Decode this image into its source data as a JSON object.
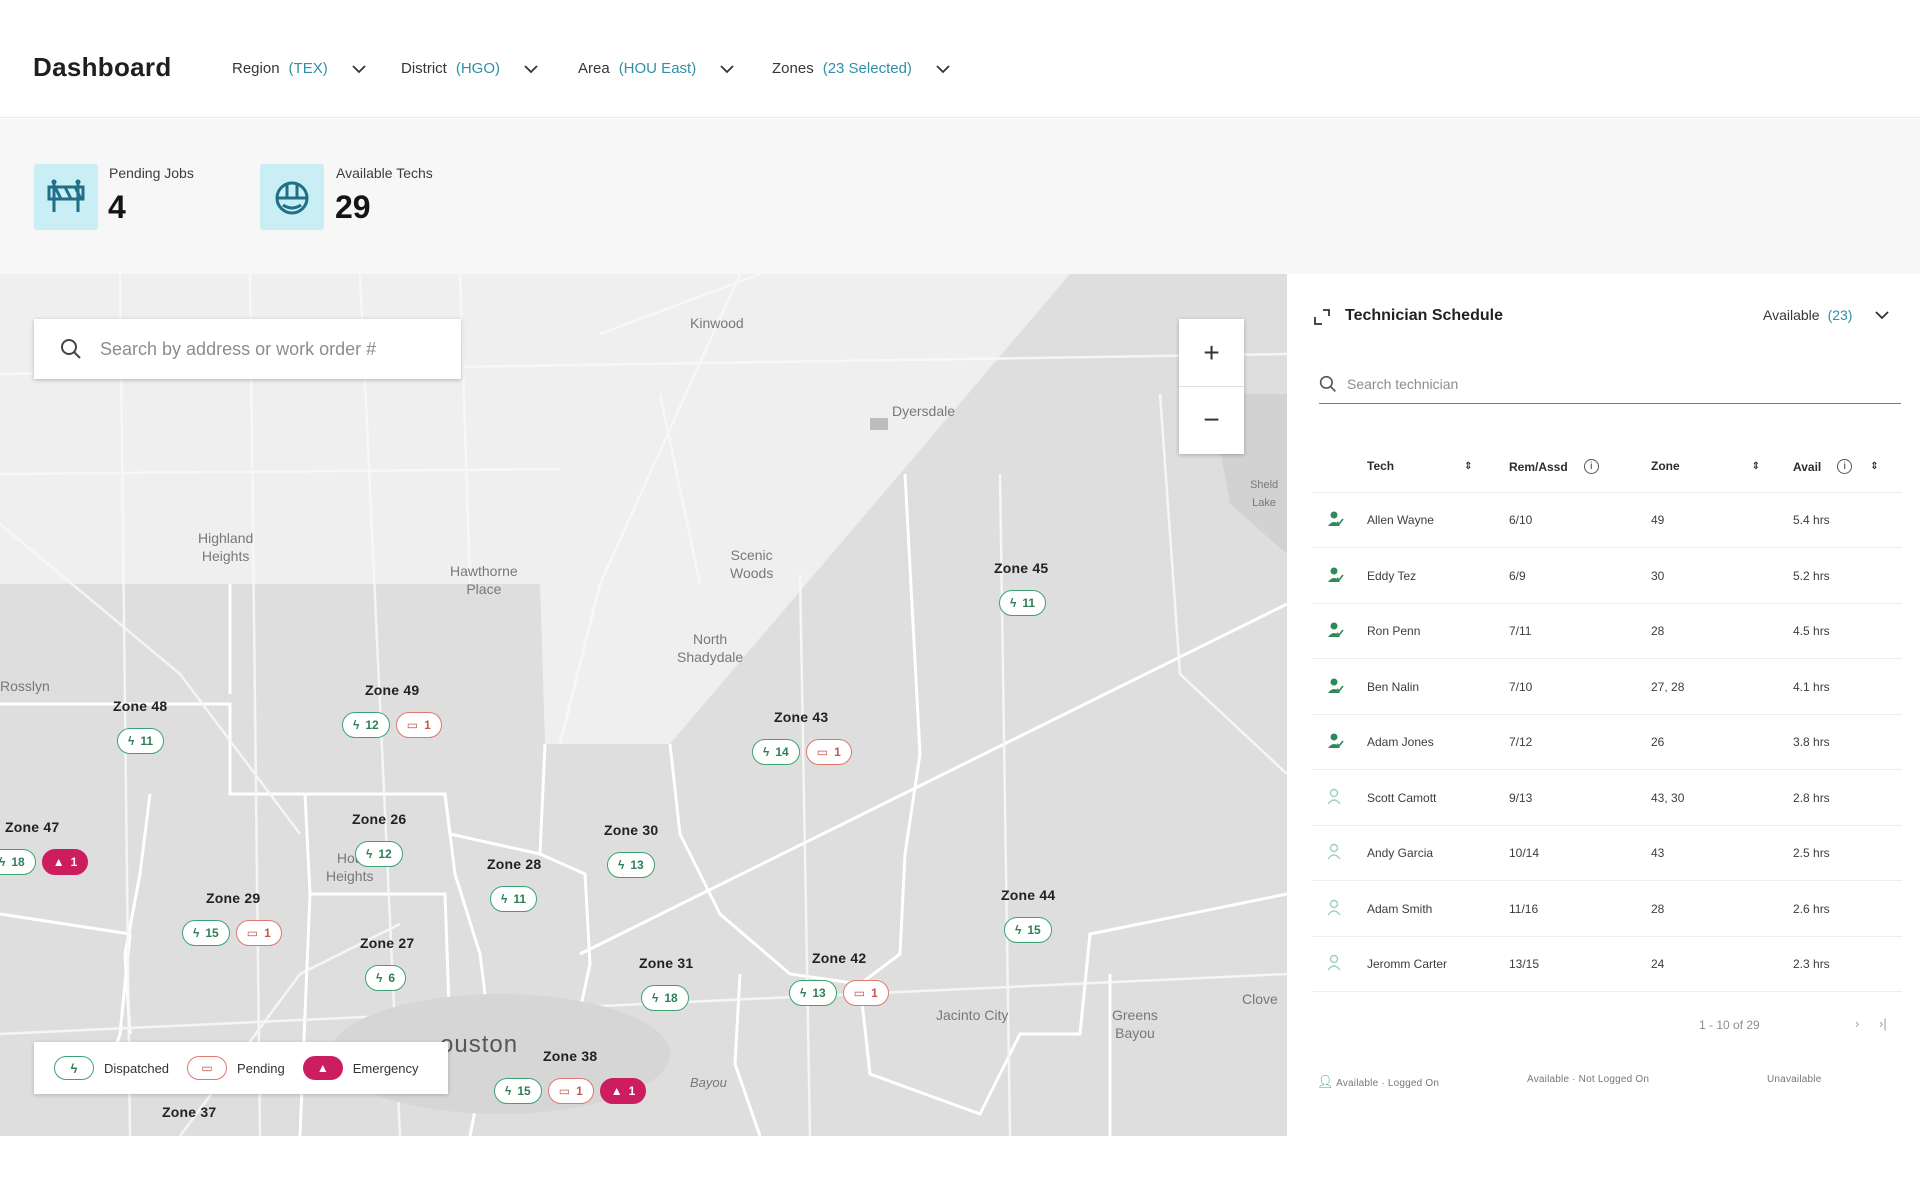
{
  "header": {
    "title": "Dashboard",
    "filters": [
      {
        "label": "Region",
        "value": "(TEX)"
      },
      {
        "label": "District",
        "value": "(HGO)"
      },
      {
        "label": "Area",
        "value": "(HOU East)"
      },
      {
        "label": "Zones",
        "value": "(23 Selected)"
      }
    ]
  },
  "stats": {
    "pending_label": "Pending Jobs",
    "pending_value": "4",
    "techs_label": "Available Techs",
    "techs_value": "29"
  },
  "map": {
    "search_placeholder": "Search by address or work order #",
    "zoom_in": "+",
    "zoom_out": "−",
    "places": {
      "kinwood": "Kinwood",
      "dyersdale": "Dyersdale",
      "highland": "Highland\nHeights",
      "hawthorne": "Hawthorne\nPlace",
      "scenic": "Scenic\nWoods",
      "north_shadydale": "North\nShadydale",
      "rosslyn": "Rosslyn",
      "hou_heights": "Hou\nHeights",
      "houston": "ouston",
      "jacinto": "Jacinto City",
      "greens": "Greens\nBayou",
      "clover": "Clove",
      "sheldon": "Sheld\nLake",
      "bayou": "Bayou"
    },
    "zones": {
      "z45": {
        "name": "Zone 45",
        "dispatched": "11"
      },
      "z48": {
        "name": "Zone 48",
        "dispatched": "11"
      },
      "z49": {
        "name": "Zone 49",
        "dispatched": "12",
        "pending": "1"
      },
      "z43": {
        "name": "Zone 43",
        "dispatched": "14",
        "pending": "1"
      },
      "z47": {
        "name": "Zone 47",
        "dispatched": "18",
        "emergency": "1"
      },
      "z26": {
        "name": "Zone 26",
        "dispatched": "12"
      },
      "z30": {
        "name": "Zone 30",
        "dispatched": "13"
      },
      "z28": {
        "name": "Zone 28",
        "dispatched": "11"
      },
      "z29": {
        "name": "Zone 29",
        "dispatched": "15",
        "pending": "1"
      },
      "z44": {
        "name": "Zone 44",
        "dispatched": "15"
      },
      "z27": {
        "name": "Zone 27",
        "dispatched": "6"
      },
      "z42": {
        "name": "Zone 42",
        "dispatched": "13",
        "pending": "1"
      },
      "z31": {
        "name": "Zone 31",
        "dispatched": "18"
      },
      "z38": {
        "name": "Zone 38",
        "dispatched": "15",
        "pending": "1",
        "emergency": "1"
      },
      "z37": {
        "name": "Zone 37"
      }
    },
    "legend": {
      "dispatched": "Dispatched",
      "pending": "Pending",
      "emergency": "Emergency"
    }
  },
  "panel": {
    "title": "Technician Schedule",
    "filter_label": "Available",
    "filter_value": "(23)",
    "search_placeholder": "Search technician",
    "columns": {
      "tech": "Tech",
      "rem": "Rem/Assd",
      "zone": "Zone",
      "avail": "Avail"
    },
    "rows": [
      {
        "tech": "Allen Wayne",
        "rem": "6/10",
        "zone": "49",
        "avail": "5.4 hrs",
        "status": "logged-on"
      },
      {
        "tech": "Eddy Tez",
        "rem": "6/9",
        "zone": "30",
        "avail": "5.2 hrs",
        "status": "logged-on"
      },
      {
        "tech": "Ron Penn",
        "rem": "7/11",
        "zone": "28",
        "avail": "4.5 hrs",
        "status": "logged-on"
      },
      {
        "tech": "Ben Nalin",
        "rem": "7/10",
        "zone": "27, 28",
        "avail": "4.1 hrs",
        "status": "logged-on"
      },
      {
        "tech": "Adam Jones",
        "rem": "7/12",
        "zone": "26",
        "avail": "3.8 hrs",
        "status": "logged-on"
      },
      {
        "tech": "Scott Camott",
        "rem": "9/13",
        "zone": "43, 30",
        "avail": "2.8 hrs",
        "status": "not-logged-on"
      },
      {
        "tech": "Andy Garcia",
        "rem": "10/14",
        "zone": "43",
        "avail": "2.5 hrs",
        "status": "not-logged-on"
      },
      {
        "tech": "Adam Smith",
        "rem": "11/16",
        "zone": "28",
        "avail": "2.6 hrs",
        "status": "not-logged-on"
      },
      {
        "tech": "Jeromm Carter",
        "rem": "13/15",
        "zone": "24",
        "avail": "2.3 hrs",
        "status": "not-logged-on"
      }
    ],
    "pager": "1 - 10 of 29",
    "pager_next": "›",
    "pager_last": "›|",
    "status_legend": {
      "a": "Available · Logged On",
      "b": "Available · Not Logged On",
      "c": "Unavailable"
    }
  },
  "colors": {
    "accent": "#2f8fa8",
    "dispatched": "#3ea372",
    "pending": "#e0786d",
    "emergency": "#cc1e5f",
    "stat_icon_bg": "#c9eef3"
  }
}
